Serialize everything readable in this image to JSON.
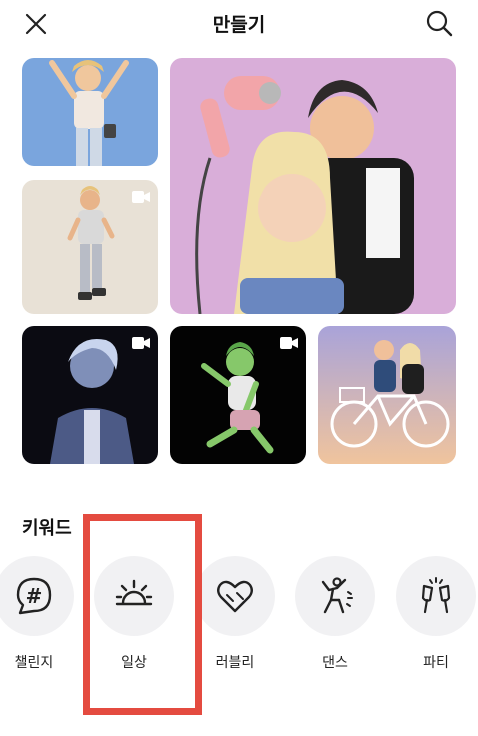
{
  "header": {
    "title": "만들기",
    "close_icon": "close-icon",
    "search_icon": "search-icon"
  },
  "gallery": [
    {
      "id": "tile-1",
      "has_video": false
    },
    {
      "id": "tile-2",
      "has_video": false
    },
    {
      "id": "tile-3",
      "has_video": true
    },
    {
      "id": "tile-4",
      "has_video": true
    },
    {
      "id": "tile-5",
      "has_video": true
    },
    {
      "id": "tile-6",
      "has_video": false
    }
  ],
  "keywords": {
    "title": "키워드",
    "items": [
      {
        "label": "챌린지",
        "icon": "hashtag-icon"
      },
      {
        "label": "일상",
        "icon": "sunrise-icon"
      },
      {
        "label": "러블리",
        "icon": "heart-icon"
      },
      {
        "label": "댄스",
        "icon": "dancing-icon"
      },
      {
        "label": "파티",
        "icon": "cheers-icon"
      }
    ]
  },
  "colors": {
    "highlight": "#e44b40",
    "circle_bg": "#f1f1f3"
  }
}
